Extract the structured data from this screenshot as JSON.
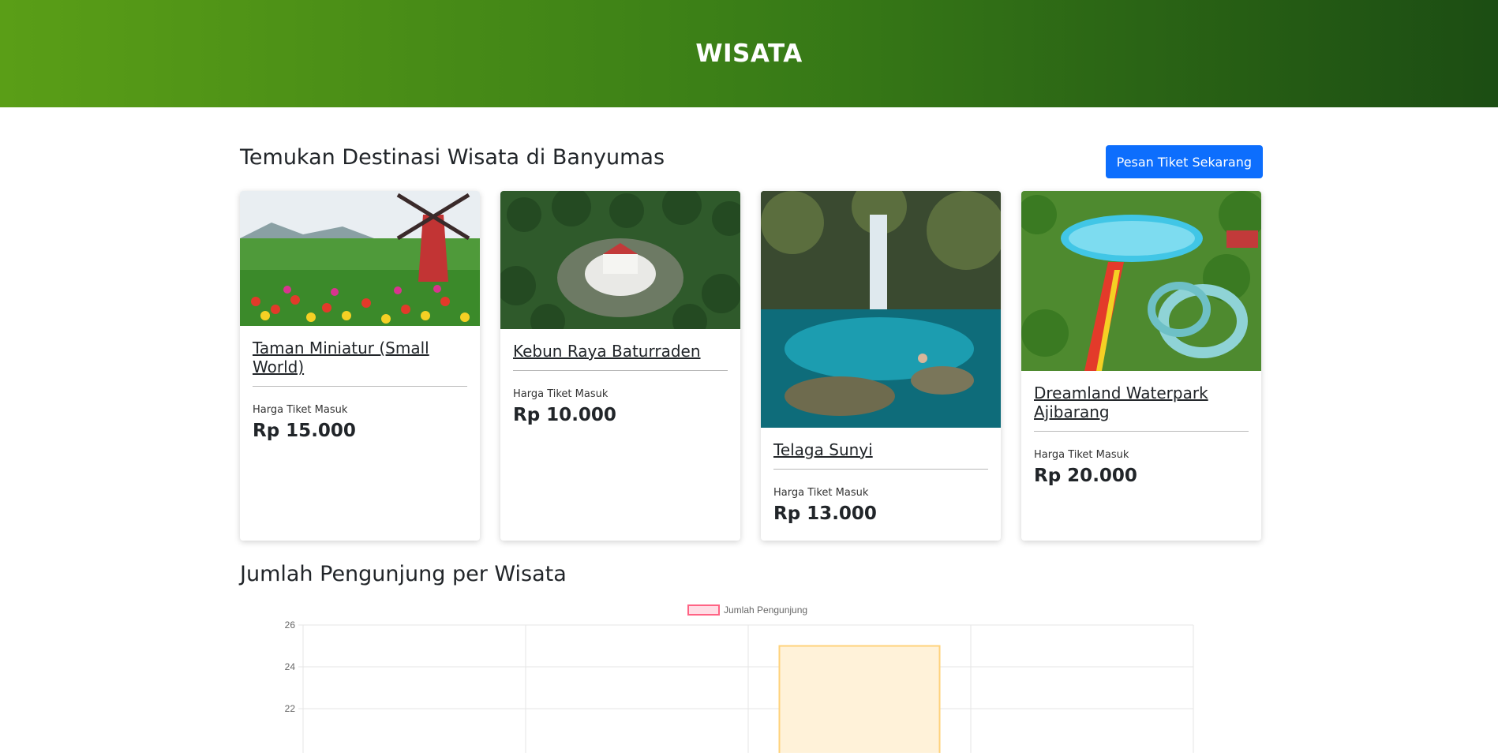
{
  "header": {
    "title": "WISATA"
  },
  "section": {
    "title": "Temukan Destinasi Wisata di Banyumas",
    "cta_label": "Pesan Tiket Sekarang"
  },
  "cards": [
    {
      "name": "Taman Miniatur (Small World)",
      "price_label": "Harga Tiket Masuk",
      "price": "Rp 15.000"
    },
    {
      "name": "Kebun Raya Baturraden",
      "price_label": "Harga Tiket Masuk",
      "price": "Rp 10.000"
    },
    {
      "name": "Telaga Sunyi",
      "price_label": "Harga Tiket Masuk",
      "price": "Rp 13.000"
    },
    {
      "name": "Dreamland Waterpark Ajibarang",
      "price_label": "Harga Tiket Masuk",
      "price": "Rp 20.000"
    }
  ],
  "chart_section": {
    "title": "Jumlah Pengunjung per Wisata"
  },
  "chart_data": {
    "type": "bar",
    "legend": "Jumlah Pengunjung",
    "legend_position": "top",
    "yticks": [
      26,
      24,
      22
    ],
    "ylim_visible": [
      20.5,
      26
    ],
    "grid": true,
    "categories_count": 4,
    "series": [
      {
        "name": "Jumlah Pengunjung",
        "values": [
          null,
          null,
          25,
          null
        ]
      }
    ],
    "colors": {
      "legend_fill": "#ffdde5",
      "legend_stroke": "#ff6384",
      "bar_fill": "#fff2d9",
      "bar_stroke": "#ffd27a"
    }
  }
}
